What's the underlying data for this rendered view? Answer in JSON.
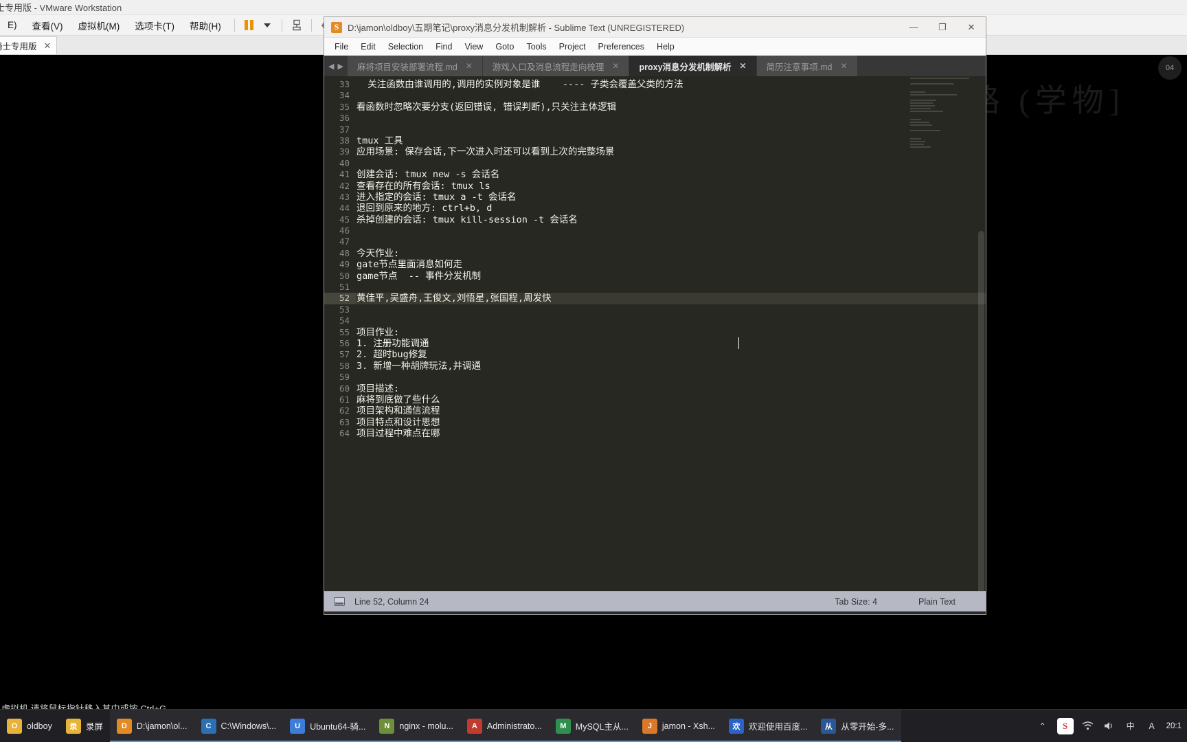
{
  "vmware": {
    "window_title": "士专用版 - VMware Workstation",
    "menu": [
      "E)",
      "查看(V)",
      "虚拟机(M)",
      "选项卡(T)",
      "帮助(H)"
    ],
    "tab_label": "骑士专用版",
    "tab_close": "✕",
    "status_hint": "虚拟机,请将鼠标指针移入其中或按 Ctrl+G。",
    "toolbar_icons": [
      "pause-icon",
      "caret-down-icon",
      "snapshot-icon",
      "take-snapshot-icon",
      "revert-snapshot-icon",
      "snapshot-manager-icon",
      "show-console-icon",
      "fullscreen-icon"
    ]
  },
  "sublime": {
    "title": "D:\\jamon\\oldboy\\五期笔记\\proxy消息分发机制解析 - Sublime Text (UNREGISTERED)",
    "window_controls": {
      "minimize": "—",
      "maximize": "❐",
      "close": "✕"
    },
    "menu": [
      "File",
      "Edit",
      "Selection",
      "Find",
      "View",
      "Goto",
      "Tools",
      "Project",
      "Preferences",
      "Help"
    ],
    "tabs": [
      {
        "label": "麻将项目安装部署流程.md",
        "active": false,
        "close": "✕"
      },
      {
        "label": "游戏入口及消息流程走向梳理",
        "active": false,
        "close": "✕"
      },
      {
        "label": "proxy消息分发机制解析",
        "active": true,
        "close": "✕"
      },
      {
        "label": "简历注意事项.md",
        "active": false,
        "close": "✕"
      }
    ],
    "tab_nav": {
      "prev": "◀",
      "next": "▶"
    },
    "statusbar": {
      "cursor": "Line 52, Column 24",
      "tab_size": "Tab Size: 4",
      "syntax": "Plain Text"
    },
    "editor": {
      "highlighted_line": 52,
      "lines": [
        {
          "n": 33,
          "text": "  关注函数由谁调用的,调用的实例对象是谁    ---- 子类会覆盖父类的方法"
        },
        {
          "n": 34,
          "text": ""
        },
        {
          "n": 35,
          "text": "看函数时忽略次要分支(返回错误, 错误判断),只关注主体逻辑"
        },
        {
          "n": 36,
          "text": ""
        },
        {
          "n": 37,
          "text": ""
        },
        {
          "n": 38,
          "text": "tmux 工具"
        },
        {
          "n": 39,
          "text": "应用场景: 保存会话,下一次进入时还可以看到上次的完整场景"
        },
        {
          "n": 40,
          "text": ""
        },
        {
          "n": 41,
          "text": "创建会话: tmux new -s 会话名"
        },
        {
          "n": 42,
          "text": "查看存在的所有会话: tmux ls"
        },
        {
          "n": 43,
          "text": "进入指定的会话: tmux a -t 会话名"
        },
        {
          "n": 44,
          "text": "退回到原来的地方: ctrl+b, d"
        },
        {
          "n": 45,
          "text": "杀掉创建的会话: tmux kill-session -t 会话名"
        },
        {
          "n": 46,
          "text": ""
        },
        {
          "n": 47,
          "text": ""
        },
        {
          "n": 48,
          "text": "今天作业:"
        },
        {
          "n": 49,
          "text": "gate节点里面消息如何走"
        },
        {
          "n": 50,
          "text": "game节点  -- 事件分发机制"
        },
        {
          "n": 51,
          "text": ""
        },
        {
          "n": 52,
          "text": "黄佳平,吴盛舟,王俊文,刘悟星,张国程,周发快"
        },
        {
          "n": 53,
          "text": ""
        },
        {
          "n": 54,
          "text": ""
        },
        {
          "n": 55,
          "text": "项目作业:"
        },
        {
          "n": 56,
          "text": "1. 注册功能调通"
        },
        {
          "n": 57,
          "text": "2. 超时bug修复"
        },
        {
          "n": 58,
          "text": "3. 新增一种胡牌玩法,并调通"
        },
        {
          "n": 59,
          "text": ""
        },
        {
          "n": 60,
          "text": "项目描述:"
        },
        {
          "n": 61,
          "text": "麻将到底做了些什么"
        },
        {
          "n": 62,
          "text": "项目架构和通信流程"
        },
        {
          "n": 63,
          "text": "项目特点和设计思想"
        },
        {
          "n": 64,
          "text": "项目过程中难点在哪"
        }
      ]
    }
  },
  "taskbar": {
    "items": [
      {
        "label": "oldboy",
        "icon": "folder-icon",
        "color": "#e8b339",
        "running": false
      },
      {
        "label": "录屏",
        "icon": "folder-icon",
        "color": "#e8b339",
        "running": false
      },
      {
        "label": "D:\\jamon\\ol...",
        "icon": "sublime-icon",
        "color": "#e48a23",
        "running": true
      },
      {
        "label": "C:\\Windows\\...",
        "icon": "terminal-icon",
        "color": "#2b6fb5",
        "running": true
      },
      {
        "label": "Ubuntu64-骑...",
        "icon": "vmware-icon",
        "color": "#3b7dd8",
        "running": true
      },
      {
        "label": "nginx - molu...",
        "icon": "editor-icon",
        "color": "#6e8f3a",
        "running": true
      },
      {
        "label": "Administrato...",
        "icon": "cmd-icon",
        "color": "#c23b2e",
        "running": true
      },
      {
        "label": "MySQL主从...",
        "icon": "mysql-icon",
        "color": "#2f8f4e",
        "running": true
      },
      {
        "label": "jamon - Xsh...",
        "icon": "xshell-icon",
        "color": "#d8792b",
        "running": true
      },
      {
        "label": "欢迎使用百度...",
        "icon": "browser-icon",
        "color": "#2b62c8",
        "running": true
      },
      {
        "label": "从零开始-多...",
        "icon": "word-icon",
        "color": "#2b5797",
        "running": true
      }
    ],
    "tray": {
      "chevron": "⌃",
      "icons": [
        "network-icon",
        "volume-icon",
        "shield-icon",
        "input-method-icon"
      ],
      "ime": "中",
      "ime_shape": "Ａ",
      "sogou": "S",
      "clock_time": "20:1",
      "date": ""
    }
  }
}
